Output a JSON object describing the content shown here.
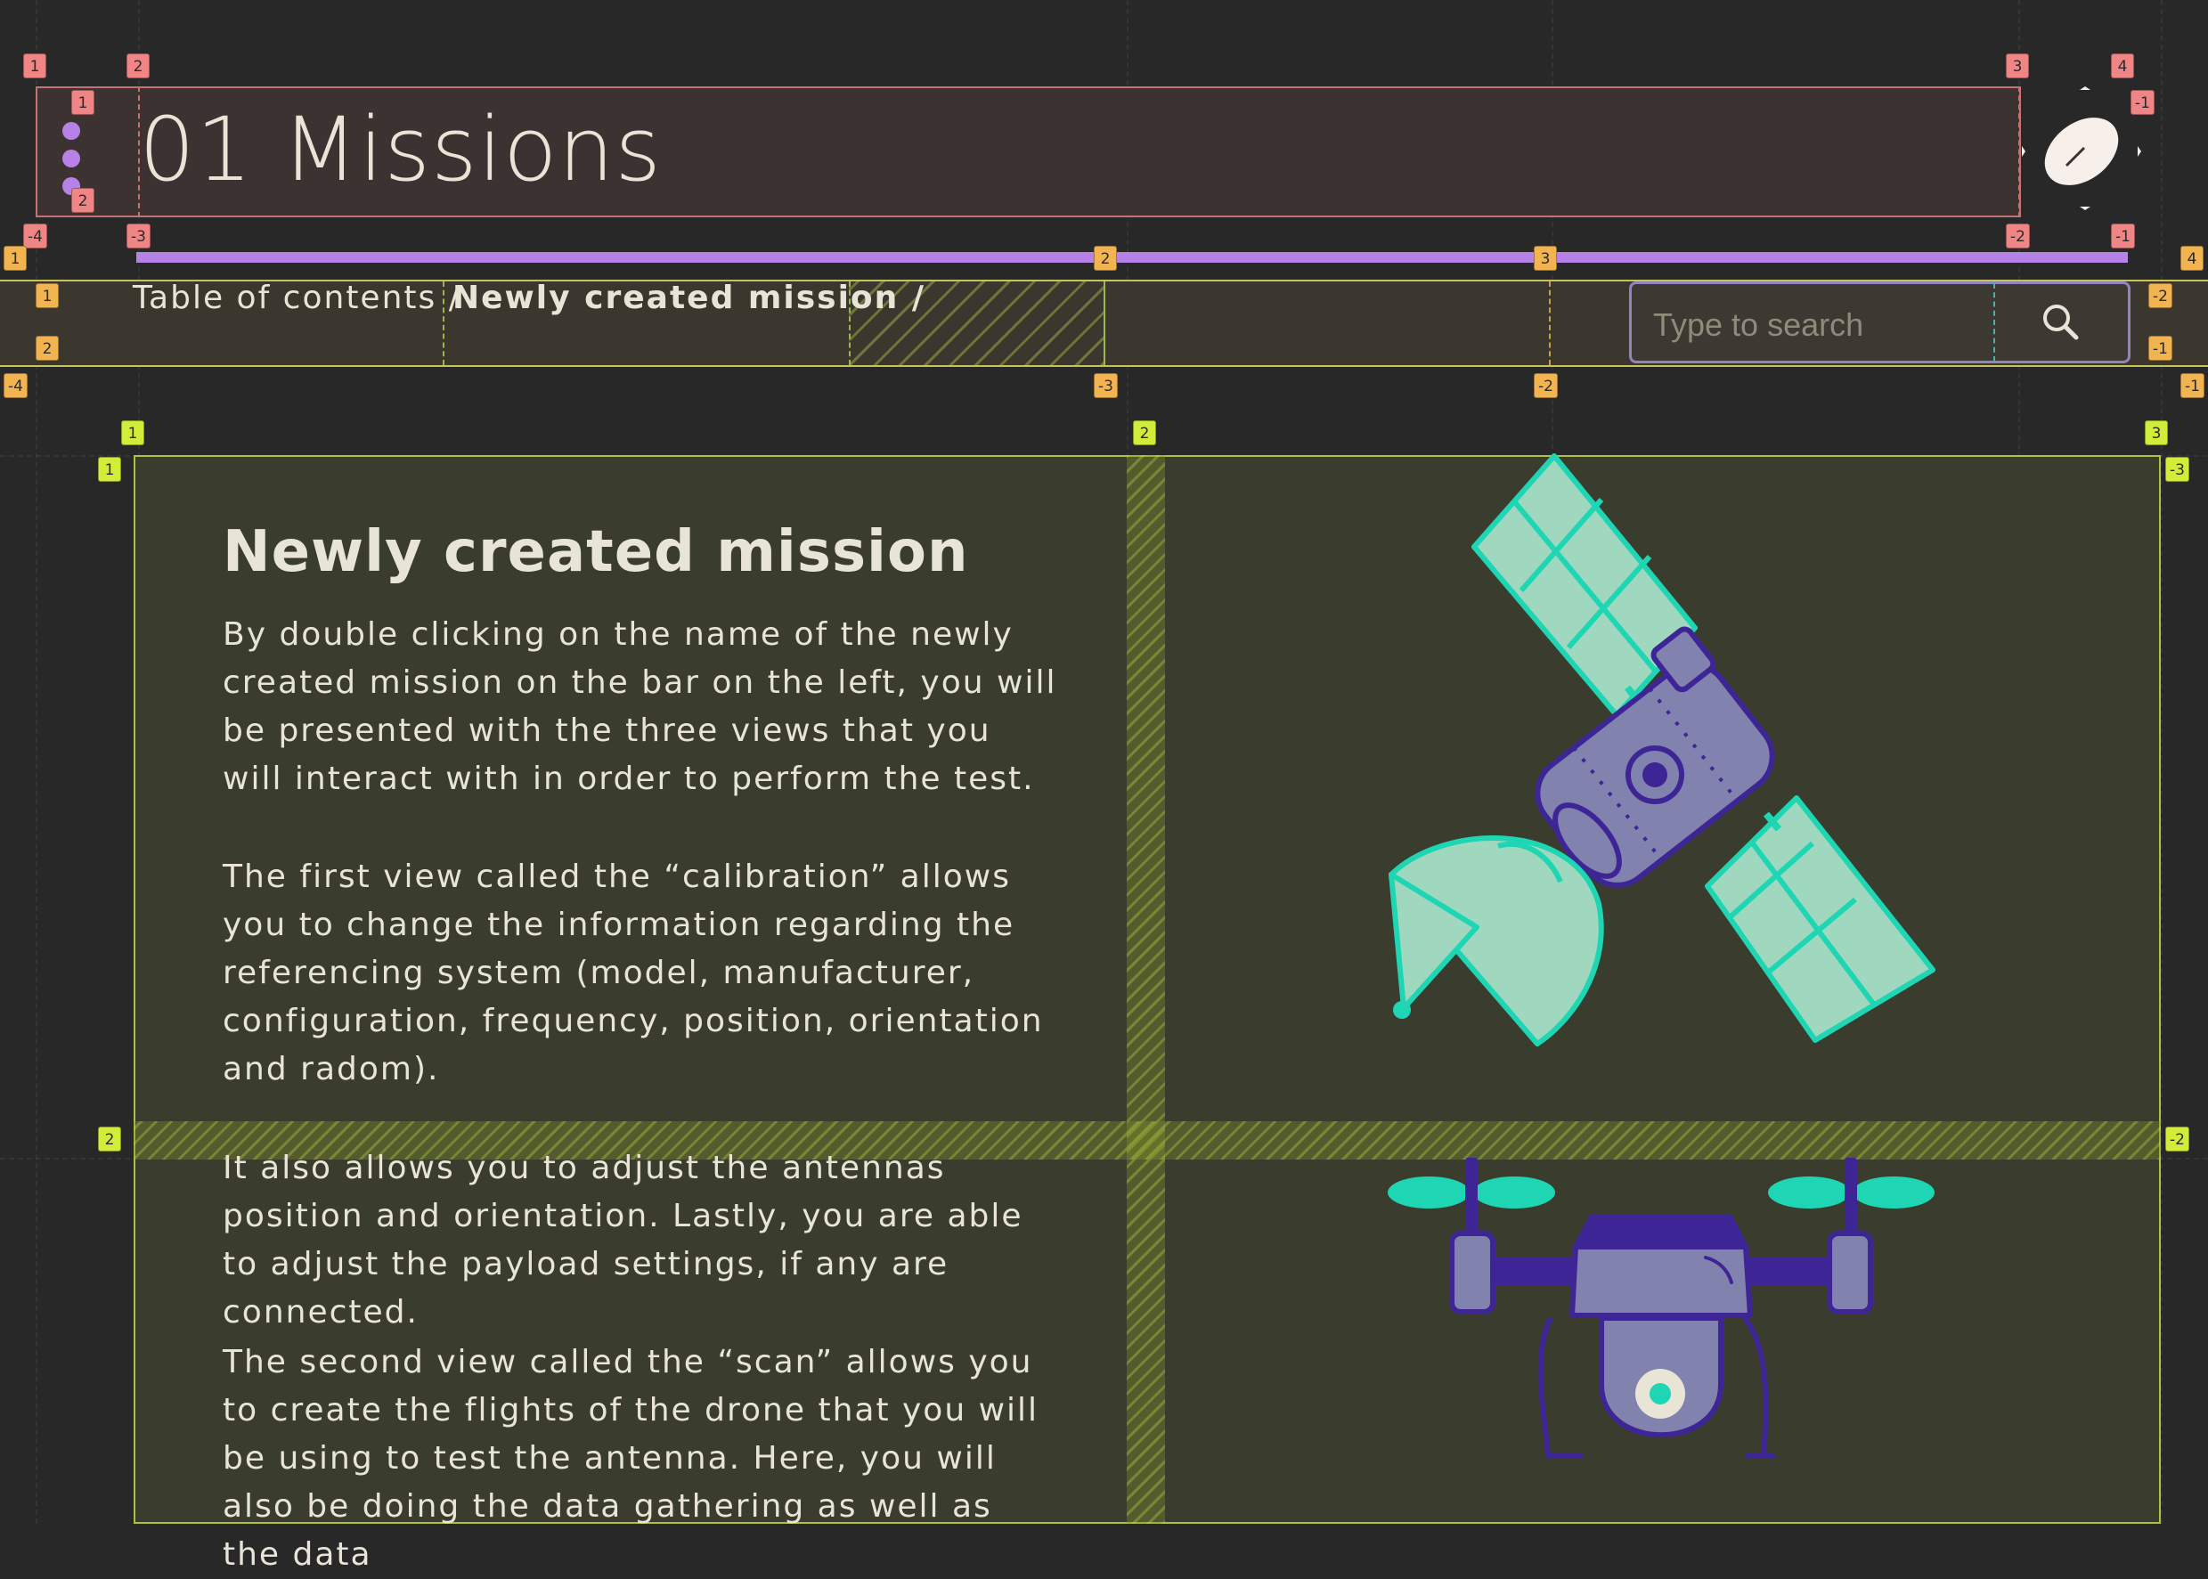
{
  "header": {
    "title": "01 Missions",
    "logo_icon": "satellite-dish-logo-icon",
    "accent_color": "#b782e8"
  },
  "breadcrumb": {
    "items": [
      "Table of contents /",
      "Newly created mission /"
    ]
  },
  "search": {
    "placeholder": "Type to search",
    "value": "",
    "icon": "search-icon"
  },
  "content": {
    "heading": "Newly created mission",
    "paragraphs": [
      "By double clicking on the name of the newly created mission on the bar on the left, you will be presented with the three views that you will interact with in order to perform the test.",
      "The first view called the “calibration” allows you to change the information regarding the referencing system (model, manufacturer, configuration, frequency, position, orientation and radom).",
      "It also allows you to adjust the antennas position and orientation. Lastly, you are able to adjust the payload settings, if any are connected.",
      "The second view called the “scan” allows you to create the flights of the drone that you will be using to test the antenna. Here, you will also be doing the data gathering as well as the data"
    ],
    "illustrations": [
      "satellite-illustration",
      "drone-illustration"
    ]
  },
  "guides": {
    "header_markers": [
      "1",
      "2",
      "3",
      "4",
      "1",
      "2",
      "-1",
      "-4",
      "-3",
      "-2",
      "-1"
    ],
    "breadcrumb_markers": [
      "1",
      "2",
      "3",
      "4",
      "1",
      "2",
      "-2",
      "-1",
      "-4",
      "-3",
      "-2",
      "-1"
    ],
    "content_markers": [
      "1",
      "2",
      "3",
      "1",
      "-3",
      "2",
      "-2"
    ]
  }
}
